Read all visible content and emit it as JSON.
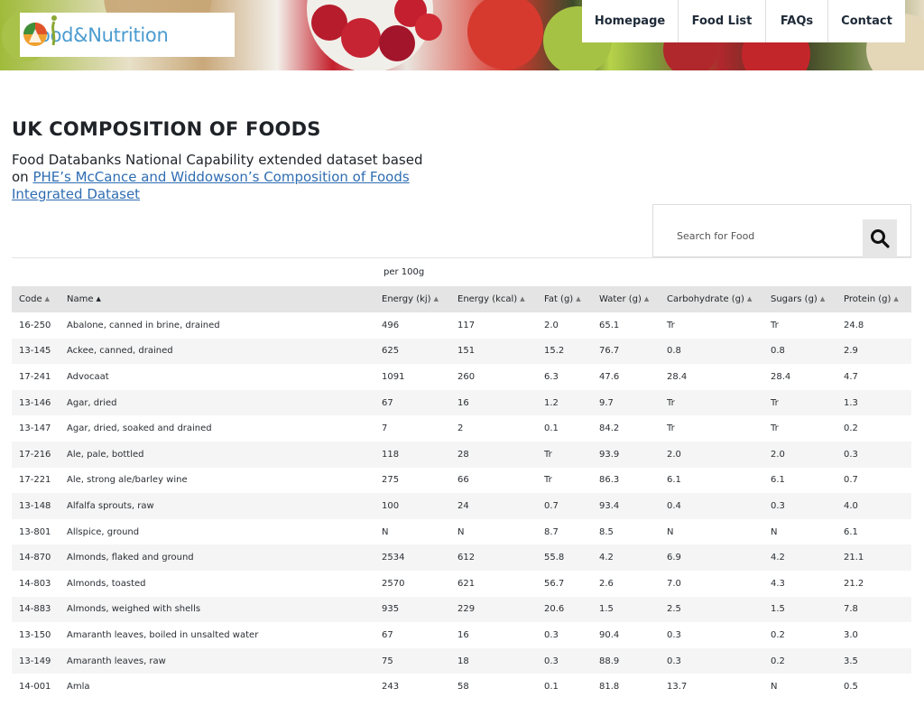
{
  "site": {
    "logo_text": "Food&Nutrition"
  },
  "nav": {
    "items": [
      {
        "label": "Homepage"
      },
      {
        "label": "Food List"
      },
      {
        "label": "FAQs"
      },
      {
        "label": "Contact"
      }
    ]
  },
  "page": {
    "title": "UK COMPOSITION OF FOODS",
    "subtitle_prefix": "Food Databanks National Capability extended dataset based on ",
    "subtitle_link": "PHE’s McCance and Widdowson’s Composition of Foods Integrated Dataset"
  },
  "search": {
    "placeholder": "Search for Food"
  },
  "table": {
    "group_label": "per 100g",
    "columns": [
      {
        "label": "Code"
      },
      {
        "label": "Name"
      },
      {
        "label": "Energy (kj)"
      },
      {
        "label": "Energy (kcal)"
      },
      {
        "label": "Fat (g)"
      },
      {
        "label": "Water (g)"
      },
      {
        "label": "Carbohydrate (g)"
      },
      {
        "label": "Sugars (g)"
      },
      {
        "label": "Protein (g)"
      }
    ],
    "rows": [
      [
        "16-250",
        "Abalone, canned in brine, drained",
        "496",
        "117",
        "2.0",
        "65.1",
        "Tr",
        "Tr",
        "24.8"
      ],
      [
        "13-145",
        "Ackee, canned, drained",
        "625",
        "151",
        "15.2",
        "76.7",
        "0.8",
        "0.8",
        "2.9"
      ],
      [
        "17-241",
        "Advocaat",
        "1091",
        "260",
        "6.3",
        "47.6",
        "28.4",
        "28.4",
        "4.7"
      ],
      [
        "13-146",
        "Agar, dried",
        "67",
        "16",
        "1.2",
        "9.7",
        "Tr",
        "Tr",
        "1.3"
      ],
      [
        "13-147",
        "Agar, dried, soaked and drained",
        "7",
        "2",
        "0.1",
        "84.2",
        "Tr",
        "Tr",
        "0.2"
      ],
      [
        "17-216",
        "Ale, pale, bottled",
        "118",
        "28",
        "Tr",
        "93.9",
        "2.0",
        "2.0",
        "0.3"
      ],
      [
        "17-221",
        "Ale, strong ale/barley wine",
        "275",
        "66",
        "Tr",
        "86.3",
        "6.1",
        "6.1",
        "0.7"
      ],
      [
        "13-148",
        "Alfalfa sprouts, raw",
        "100",
        "24",
        "0.7",
        "93.4",
        "0.4",
        "0.3",
        "4.0"
      ],
      [
        "13-801",
        "Allspice, ground",
        "N",
        "N",
        "8.7",
        "8.5",
        "N",
        "N",
        "6.1"
      ],
      [
        "14-870",
        "Almonds, flaked and ground",
        "2534",
        "612",
        "55.8",
        "4.2",
        "6.9",
        "4.2",
        "21.1"
      ],
      [
        "14-803",
        "Almonds, toasted",
        "2570",
        "621",
        "56.7",
        "2.6",
        "7.0",
        "4.3",
        "21.2"
      ],
      [
        "14-883",
        "Almonds, weighed with shells",
        "935",
        "229",
        "20.6",
        "1.5",
        "2.5",
        "1.5",
        "7.8"
      ],
      [
        "13-150",
        "Amaranth leaves, boiled in unsalted water",
        "67",
        "16",
        "0.3",
        "90.4",
        "0.3",
        "0.2",
        "3.0"
      ],
      [
        "13-149",
        "Amaranth leaves, raw",
        "75",
        "18",
        "0.3",
        "88.9",
        "0.3",
        "0.2",
        "3.5"
      ],
      [
        "14-001",
        "Amla",
        "243",
        "58",
        "0.1",
        "81.8",
        "13.7",
        "N",
        "0.5"
      ]
    ]
  }
}
